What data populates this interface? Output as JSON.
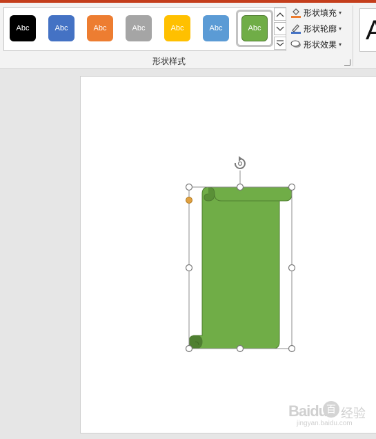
{
  "ribbon": {
    "shape_styles": [
      {
        "label": "Abc",
        "color": "#000000"
      },
      {
        "label": "Abc",
        "color": "#4472c4"
      },
      {
        "label": "Abc",
        "color": "#ed7d31"
      },
      {
        "label": "Abc",
        "color": "#a5a5a5"
      },
      {
        "label": "Abc",
        "color": "#ffc000"
      },
      {
        "label": "Abc",
        "color": "#5b9bd5"
      },
      {
        "label": "Abc",
        "color": "#70ad47"
      }
    ],
    "selected_style_index": 6,
    "shape_fill": "形状填充",
    "shape_outline": "形状轮廓",
    "shape_effects": "形状效果",
    "group_label": "形状样式",
    "wordart_glyph": "A"
  },
  "shape": {
    "type": "vertical-scroll",
    "fill_color": "#70ad47",
    "outline_color": "#507e32",
    "adjust_handle_color": "#e0a040"
  },
  "watermark": {
    "brand": "Baidu",
    "paw": "百",
    "suffix": "经验",
    "url": "jingyan.baidu.com"
  }
}
